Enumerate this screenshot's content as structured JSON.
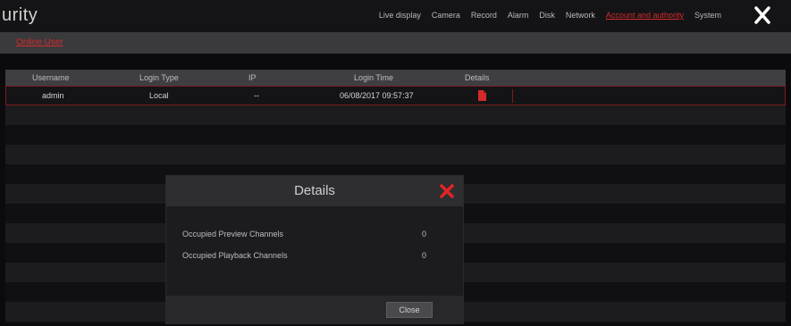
{
  "header": {
    "title": "urity",
    "nav": [
      {
        "label": "Live display",
        "active": false
      },
      {
        "label": "Camera",
        "active": false
      },
      {
        "label": "Record",
        "active": false
      },
      {
        "label": "Alarm",
        "active": false
      },
      {
        "label": "Disk",
        "active": false
      },
      {
        "label": "Network",
        "active": false
      },
      {
        "label": "Account and authority",
        "active": true
      },
      {
        "label": "System",
        "active": false
      }
    ],
    "close_icon": "close-icon"
  },
  "subnav": {
    "tab": "Online User"
  },
  "table": {
    "columns": [
      "Username",
      "Login Type",
      "IP",
      "Login Time",
      "Details"
    ],
    "rows": [
      {
        "username": "admin",
        "login_type": "Local",
        "ip": "--",
        "login_time": "06/08/2017 09:57:37",
        "details_icon": "document-icon"
      }
    ]
  },
  "dialog": {
    "title": "Details",
    "lines": [
      {
        "label": "Occupied Preview Channels",
        "value": "0"
      },
      {
        "label": "Occupied Playback Channels",
        "value": "0"
      }
    ],
    "close_button": "Close"
  },
  "colors": {
    "accent": "#d42a2a",
    "background": "#0b0b0d"
  }
}
